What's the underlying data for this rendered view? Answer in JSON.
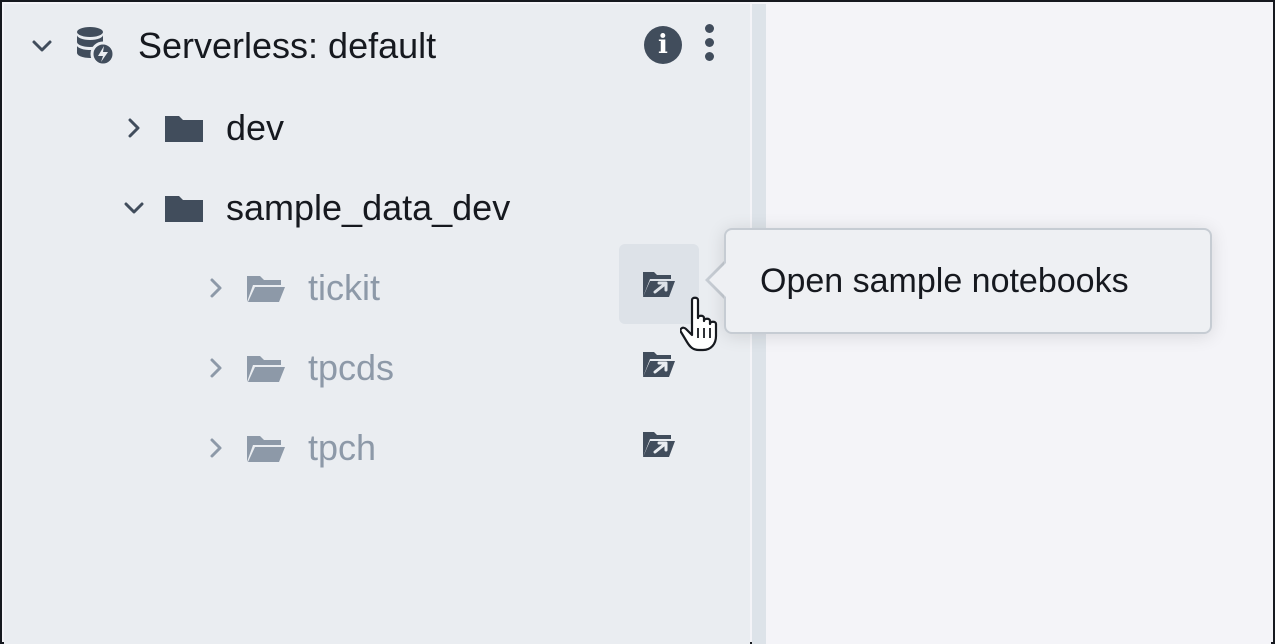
{
  "tree": {
    "root": {
      "label": "Serverless: default",
      "icon": "serverless-database-icon",
      "expanded": true
    },
    "items": [
      {
        "label": "dev",
        "icon": "folder-icon",
        "expanded": false
      },
      {
        "label": "sample_data_dev",
        "icon": "folder-icon",
        "expanded": true,
        "children": [
          {
            "label": "tickit",
            "icon": "folder-open-icon",
            "action_icon": "open-notebook-icon"
          },
          {
            "label": "tpcds",
            "icon": "folder-open-icon",
            "action_icon": "open-notebook-icon"
          },
          {
            "label": "tpch",
            "icon": "folder-open-icon",
            "action_icon": "open-notebook-icon"
          }
        ]
      }
    ]
  },
  "header_actions": {
    "info_glyph": "i",
    "info_icon": "info-icon",
    "more_icon": "more-vertical-icon"
  },
  "tooltip": {
    "text": "Open sample notebooks"
  },
  "colors": {
    "text": "#16191f",
    "muted": "#8d99a8",
    "icon": "#414d5c",
    "sidebar_bg": "#eaedf1",
    "main_bg": "#f4f4f8"
  }
}
